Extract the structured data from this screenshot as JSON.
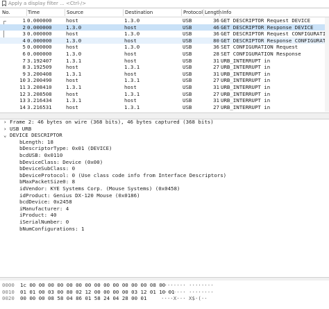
{
  "filter": {
    "placeholder": "Apply a display filter ... <Ctrl-/>"
  },
  "columns": {
    "no": "No.",
    "time": "Time",
    "source": "Source",
    "destination": "Destination",
    "protocol": "Protocol",
    "length": "Length",
    "info": "Info"
  },
  "packets": [
    {
      "no": "1",
      "time": "0.000000",
      "source": "host",
      "destination": "1.3.0",
      "protocol": "USB",
      "length": "36",
      "info": "GET DESCRIPTOR Request DEVICE",
      "state": "normal"
    },
    {
      "no": "2",
      "time": "0.000000",
      "source": "1.3.0",
      "destination": "host",
      "protocol": "USB",
      "length": "46",
      "info": "GET DESCRIPTOR Response DEVICE",
      "state": "selected"
    },
    {
      "no": "3",
      "time": "0.000000",
      "source": "host",
      "destination": "1.3.0",
      "protocol": "USB",
      "length": "36",
      "info": "GET DESCRIPTOR Request CONFIGURATION",
      "state": "normal"
    },
    {
      "no": "4",
      "time": "0.000000",
      "source": "1.3.0",
      "destination": "host",
      "protocol": "USB",
      "length": "80",
      "info": "GET DESCRIPTOR Response CONFIGURATION",
      "state": "related"
    },
    {
      "no": "5",
      "time": "0.000000",
      "source": "host",
      "destination": "1.3.0",
      "protocol": "USB",
      "length": "36",
      "info": "SET CONFIGURATION Request",
      "state": "normal"
    },
    {
      "no": "6",
      "time": "0.000000",
      "source": "1.3.0",
      "destination": "host",
      "protocol": "USB",
      "length": "28",
      "info": "SET CONFIGURATION Response",
      "state": "normal"
    },
    {
      "no": "7",
      "time": "3.192407",
      "source": "1.3.1",
      "destination": "host",
      "protocol": "USB",
      "length": "31",
      "info": "URB_INTERRUPT in",
      "state": "normal"
    },
    {
      "no": "8",
      "time": "3.192509",
      "source": "host",
      "destination": "1.3.1",
      "protocol": "USB",
      "length": "27",
      "info": "URB_INTERRUPT in",
      "state": "normal"
    },
    {
      "no": "9",
      "time": "3.200408",
      "source": "1.3.1",
      "destination": "host",
      "protocol": "USB",
      "length": "31",
      "info": "URB_INTERRUPT in",
      "state": "normal"
    },
    {
      "no": "10",
      "time": "3.200490",
      "source": "host",
      "destination": "1.3.1",
      "protocol": "USB",
      "length": "27",
      "info": "URB_INTERRUPT in",
      "state": "normal"
    },
    {
      "no": "11",
      "time": "3.208410",
      "source": "1.3.1",
      "destination": "host",
      "protocol": "USB",
      "length": "31",
      "info": "URB_INTERRUPT in",
      "state": "normal"
    },
    {
      "no": "12",
      "time": "3.208508",
      "source": "host",
      "destination": "1.3.1",
      "protocol": "USB",
      "length": "27",
      "info": "URB_INTERRUPT in",
      "state": "normal"
    },
    {
      "no": "13",
      "time": "3.216434",
      "source": "1.3.1",
      "destination": "host",
      "protocol": "USB",
      "length": "31",
      "info": "URB_INTERRUPT in",
      "state": "normal"
    },
    {
      "no": "14",
      "time": "3.216531",
      "source": "host",
      "destination": "1.3.1",
      "protocol": "USB",
      "length": "27",
      "info": "URB_INTERRUPT in",
      "state": "normal"
    }
  ],
  "details": {
    "frame": "Frame 2: 46 bytes on wire (368 bits), 46 bytes captured (368 bits)",
    "usb_urb": "USB URB",
    "descriptor": "DEVICE DESCRIPTOR",
    "fields": [
      "bLength: 18",
      "bDescriptorType: 0x01 (DEVICE)",
      "bcdUSB: 0x0110",
      "bDeviceClass: Device (0x00)",
      "bDeviceSubClass: 0",
      "bDeviceProtocol: 0 (Use class code info from Interface Descriptors)",
      "bMaxPacketSize0: 8",
      "idVendor: KYE Systems Corp. (Mouse Systems) (0x0458)",
      "idProduct: Genius DX-120 Mouse (0x0186)",
      "bcdDevice: 0x2458",
      "iManufacturer: 4",
      "iProduct: 40",
      "iSerialNumber: 0",
      "bNumConfigurations: 1"
    ]
  },
  "hex": [
    {
      "offset": "0000",
      "bytes": "1c 00 00 00 00 00 00 00  00 00 00 00 00 00 08 00",
      "ascii": "········ ········"
    },
    {
      "offset": "0010",
      "bytes": "01 01 00 03 00 80 02 12  00 00 00 00 03 12 01 10 01",
      "ascii": "········ ········"
    },
    {
      "offset": "0020",
      "bytes": "00 00 00 08 58 04 86 01  58 24 04 28 00 01",
      "ascii": "····X··· X$·(··"
    }
  ]
}
